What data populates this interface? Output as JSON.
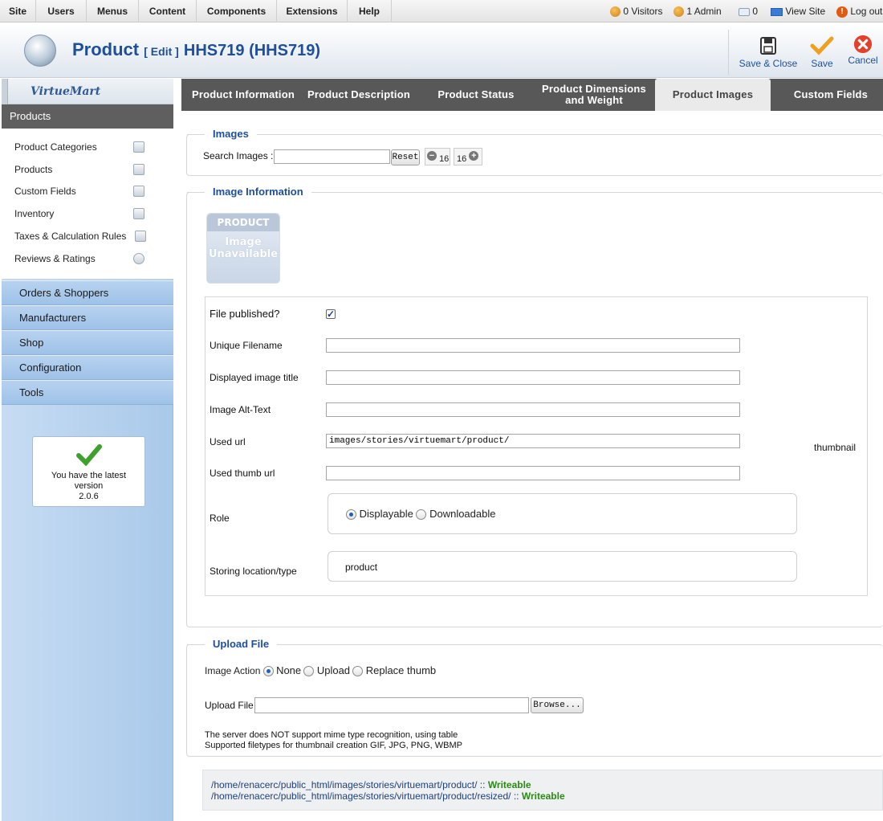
{
  "topmenu": {
    "items": [
      "Site",
      "Users",
      "Menus",
      "Content",
      "Components",
      "Extensions",
      "Help"
    ],
    "status": {
      "visitors": "0 Visitors",
      "admin": "1 Admin",
      "messages": "0",
      "view_site": "View Site",
      "logout": "Log out"
    }
  },
  "header": {
    "title": "Product",
    "edit": "[ Edit ]",
    "code": "HHS719 (HHS719)",
    "buttons": {
      "save_close": "Save & Close",
      "save": "Save",
      "cancel": "Cancel"
    }
  },
  "sidebar": {
    "brand": "VirtueMart",
    "section": "Products",
    "items": [
      "Product Categories",
      "Products",
      "Custom Fields",
      "Inventory",
      "Taxes & Calculation Rules",
      "Reviews & Ratings"
    ],
    "sections": [
      "Orders & Shoppers",
      "Manufacturers",
      "Shop",
      "Configuration",
      "Tools"
    ],
    "version": {
      "line1": "You have the latest",
      "line2": "version",
      "number": "2.0.6"
    }
  },
  "tabs": [
    "Product Information",
    "Product Description",
    "Product Status",
    "Product Dimensions and Weight",
    "Product Images",
    "Custom Fields"
  ],
  "active_tab": "Product Images",
  "images": {
    "legend": "Images",
    "search_label": "Search Images :",
    "search_value": "",
    "reset": "Reset",
    "prev_count": "16",
    "next_count": "16"
  },
  "info": {
    "legend": "Image Information",
    "placeholder": {
      "top": "PRODUCT",
      "line1": "Image",
      "line2": "Unavailable"
    },
    "published_label": "File published?",
    "published": true,
    "unique_filename": {
      "label": "Unique Filename",
      "value": ""
    },
    "image_title": {
      "label": "Displayed image title",
      "value": ""
    },
    "alt_text": {
      "label": "Image Alt-Text",
      "value": ""
    },
    "used_url": {
      "label": "Used url",
      "value": "images/stories/virtuemart/product/"
    },
    "thumb_url": {
      "label": "Used thumb url",
      "value": ""
    },
    "thumbnail": "thumbnail",
    "role": {
      "label": "Role",
      "options": [
        "Displayable",
        "Downloadable"
      ],
      "selected": "Displayable"
    },
    "storing": {
      "label": "Storing location/type",
      "value": "product"
    }
  },
  "upload": {
    "legend": "Upload File",
    "action_label": "Image Action",
    "actions": [
      "None",
      "Upload",
      "Replace thumb"
    ],
    "selected": "None",
    "file_label": "Upload File",
    "browse": "Browse...",
    "note1": "The server does NOT support mime type recognition, using table",
    "note2": "Supported filetypes for thumbnail creation GIF, JPG, PNG, WBMP"
  },
  "paths": [
    {
      "path": "/home/renacerc/public_html/images/stories/virtuemart/product/ :: ",
      "status": "Writeable"
    },
    {
      "path": "/home/renacerc/public_html/images/stories/virtuemart/product/resized/ :: ",
      "status": "Writeable"
    }
  ],
  "colors": {
    "link": "#1d4f9c",
    "ok": "#2a8a12",
    "tabbar": "#585858"
  }
}
